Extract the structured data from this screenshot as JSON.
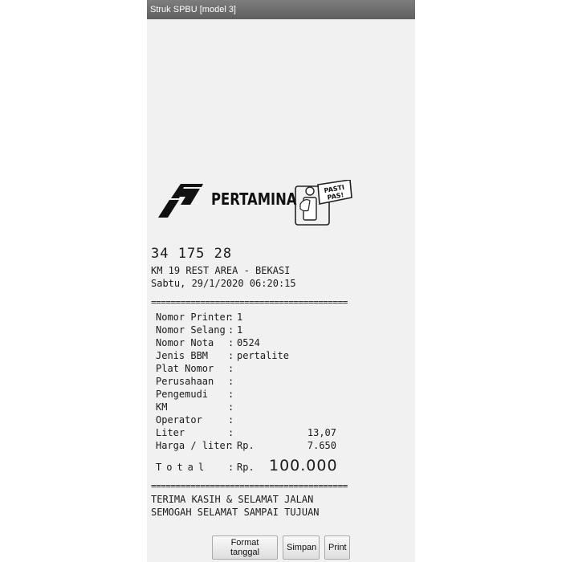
{
  "window": {
    "title": "Struk SPBU [model 3]"
  },
  "brand": {
    "name": "PERTAMINA",
    "badge": "PASTI PAS!"
  },
  "receipt": {
    "station_code": "34 175 28",
    "location": "KM 19 REST AREA - BEKASI",
    "datetime": "Sabtu, 29/1/2020 06:20:15",
    "separator": "========================================",
    "fields": [
      {
        "label": "Nomor Printer",
        "value": "1"
      },
      {
        "label": "Nomor Selang",
        "value": "1"
      },
      {
        "label": "Nomor Nota",
        "value": "0524"
      },
      {
        "label": "Jenis BBM",
        "value": "pertalite"
      },
      {
        "label": "Plat Nomor",
        "value": ""
      },
      {
        "label": "Perusahaan",
        "value": ""
      },
      {
        "label": "Pengemudi",
        "value": ""
      },
      {
        "label": "KM",
        "value": ""
      },
      {
        "label": "Operator",
        "value": ""
      }
    ],
    "liter": {
      "label": "Liter",
      "value": "13,07"
    },
    "price": {
      "label": "Harga / liter",
      "currency": "Rp.",
      "value": "7.650"
    },
    "total": {
      "label": "Total",
      "currency": "Rp.",
      "value": "100.000"
    },
    "colon": ":",
    "footer_line1": "TERIMA KASIH & SELAMAT JALAN",
    "footer_line2": "SEMOGAH SELAMAT SAMPAI TUJUAN"
  },
  "buttons": {
    "format_date": "Format tanggal",
    "save": "Simpan",
    "print": "Print"
  },
  "colors": {
    "titlebar": "#6b6b6b",
    "receipt_bg": "#f1f1f1",
    "logo_dark": "#111111"
  }
}
